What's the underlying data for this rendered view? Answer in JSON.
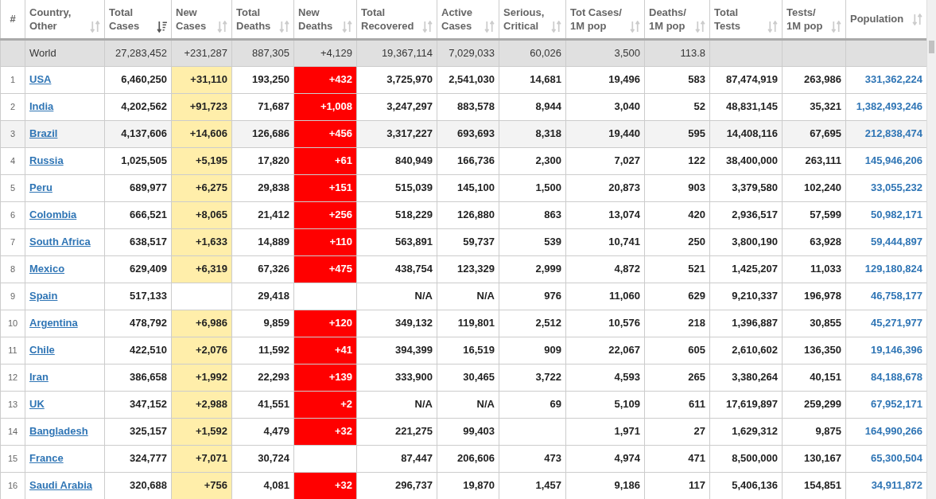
{
  "table": {
    "columns": [
      {
        "label": "#",
        "kind": "index"
      },
      {
        "label": "Country,\nOther",
        "kind": "country",
        "sorted": false
      },
      {
        "label": "Total\nCases",
        "kind": "plain",
        "sorted": true
      },
      {
        "label": "New\nCases",
        "kind": "newcases",
        "sorted": false
      },
      {
        "label": "Total\nDeaths",
        "kind": "plain",
        "sorted": false
      },
      {
        "label": "New\nDeaths",
        "kind": "newdeaths",
        "sorted": false
      },
      {
        "label": "Total\nRecovered",
        "kind": "plain",
        "sorted": false
      },
      {
        "label": "Active\nCases",
        "kind": "plain",
        "sorted": false
      },
      {
        "label": "Serious,\nCritical",
        "kind": "plain",
        "sorted": false
      },
      {
        "label": "Tot Cases/\n1M pop",
        "kind": "plain",
        "sorted": false
      },
      {
        "label": "Deaths/\n1M pop",
        "kind": "plain",
        "sorted": false
      },
      {
        "label": "Total\nTests",
        "kind": "plain",
        "sorted": false
      },
      {
        "label": "Tests/\n1M pop",
        "kind": "plain",
        "sorted": false
      },
      {
        "label": "Population",
        "kind": "population",
        "sorted": false
      }
    ],
    "world": {
      "cells": [
        "",
        "World",
        "27,283,452",
        "+231,287",
        "887,305",
        "+4,129",
        "19,367,114",
        "7,029,033",
        "60,026",
        "3,500",
        "113.8",
        "",
        "",
        ""
      ]
    },
    "rows": [
      {
        "highlighted": false,
        "cells": [
          "1",
          "USA",
          "6,460,250",
          "+31,110",
          "193,250",
          "+432",
          "3,725,970",
          "2,541,030",
          "14,681",
          "19,496",
          "583",
          "87,474,919",
          "263,986",
          "331,362,224"
        ]
      },
      {
        "highlighted": false,
        "cells": [
          "2",
          "India",
          "4,202,562",
          "+91,723",
          "71,687",
          "+1,008",
          "3,247,297",
          "883,578",
          "8,944",
          "3,040",
          "52",
          "48,831,145",
          "35,321",
          "1,382,493,246"
        ]
      },
      {
        "highlighted": true,
        "cells": [
          "3",
          "Brazil",
          "4,137,606",
          "+14,606",
          "126,686",
          "+456",
          "3,317,227",
          "693,693",
          "8,318",
          "19,440",
          "595",
          "14,408,116",
          "67,695",
          "212,838,474"
        ]
      },
      {
        "highlighted": false,
        "cells": [
          "4",
          "Russia",
          "1,025,505",
          "+5,195",
          "17,820",
          "+61",
          "840,949",
          "166,736",
          "2,300",
          "7,027",
          "122",
          "38,400,000",
          "263,111",
          "145,946,206"
        ]
      },
      {
        "highlighted": false,
        "cells": [
          "5",
          "Peru",
          "689,977",
          "+6,275",
          "29,838",
          "+151",
          "515,039",
          "145,100",
          "1,500",
          "20,873",
          "903",
          "3,379,580",
          "102,240",
          "33,055,232"
        ]
      },
      {
        "highlighted": false,
        "cells": [
          "6",
          "Colombia",
          "666,521",
          "+8,065",
          "21,412",
          "+256",
          "518,229",
          "126,880",
          "863",
          "13,074",
          "420",
          "2,936,517",
          "57,599",
          "50,982,171"
        ]
      },
      {
        "highlighted": false,
        "cells": [
          "7",
          "South Africa",
          "638,517",
          "+1,633",
          "14,889",
          "+110",
          "563,891",
          "59,737",
          "539",
          "10,741",
          "250",
          "3,800,190",
          "63,928",
          "59,444,897"
        ]
      },
      {
        "highlighted": false,
        "cells": [
          "8",
          "Mexico",
          "629,409",
          "+6,319",
          "67,326",
          "+475",
          "438,754",
          "123,329",
          "2,999",
          "4,872",
          "521",
          "1,425,207",
          "11,033",
          "129,180,824"
        ]
      },
      {
        "highlighted": false,
        "cells": [
          "9",
          "Spain",
          "517,133",
          "",
          "29,418",
          "",
          "N/A",
          "N/A",
          "976",
          "11,060",
          "629",
          "9,210,337",
          "196,978",
          "46,758,177"
        ]
      },
      {
        "highlighted": false,
        "cells": [
          "10",
          "Argentina",
          "478,792",
          "+6,986",
          "9,859",
          "+120",
          "349,132",
          "119,801",
          "2,512",
          "10,576",
          "218",
          "1,396,887",
          "30,855",
          "45,271,977"
        ]
      },
      {
        "highlighted": false,
        "cells": [
          "11",
          "Chile",
          "422,510",
          "+2,076",
          "11,592",
          "+41",
          "394,399",
          "16,519",
          "909",
          "22,067",
          "605",
          "2,610,602",
          "136,350",
          "19,146,396"
        ]
      },
      {
        "highlighted": false,
        "cells": [
          "12",
          "Iran",
          "386,658",
          "+1,992",
          "22,293",
          "+139",
          "333,900",
          "30,465",
          "3,722",
          "4,593",
          "265",
          "3,380,264",
          "40,151",
          "84,188,678"
        ]
      },
      {
        "highlighted": false,
        "cells": [
          "13",
          "UK",
          "347,152",
          "+2,988",
          "41,551",
          "+2",
          "N/A",
          "N/A",
          "69",
          "5,109",
          "611",
          "17,619,897",
          "259,299",
          "67,952,171"
        ]
      },
      {
        "highlighted": false,
        "cells": [
          "14",
          "Bangladesh",
          "325,157",
          "+1,592",
          "4,479",
          "+32",
          "221,275",
          "99,403",
          "",
          "1,971",
          "27",
          "1,629,312",
          "9,875",
          "164,990,266"
        ]
      },
      {
        "highlighted": false,
        "cells": [
          "15",
          "France",
          "324,777",
          "+7,071",
          "30,724",
          "",
          "87,447",
          "206,606",
          "473",
          "4,974",
          "471",
          "8,500,000",
          "130,167",
          "65,300,504"
        ]
      },
      {
        "highlighted": false,
        "cells": [
          "16",
          "Saudi Arabia",
          "320,688",
          "+756",
          "4,081",
          "+32",
          "296,737",
          "19,870",
          "1,457",
          "9,186",
          "117",
          "5,406,136",
          "154,851",
          "34,911,872"
        ]
      }
    ]
  }
}
